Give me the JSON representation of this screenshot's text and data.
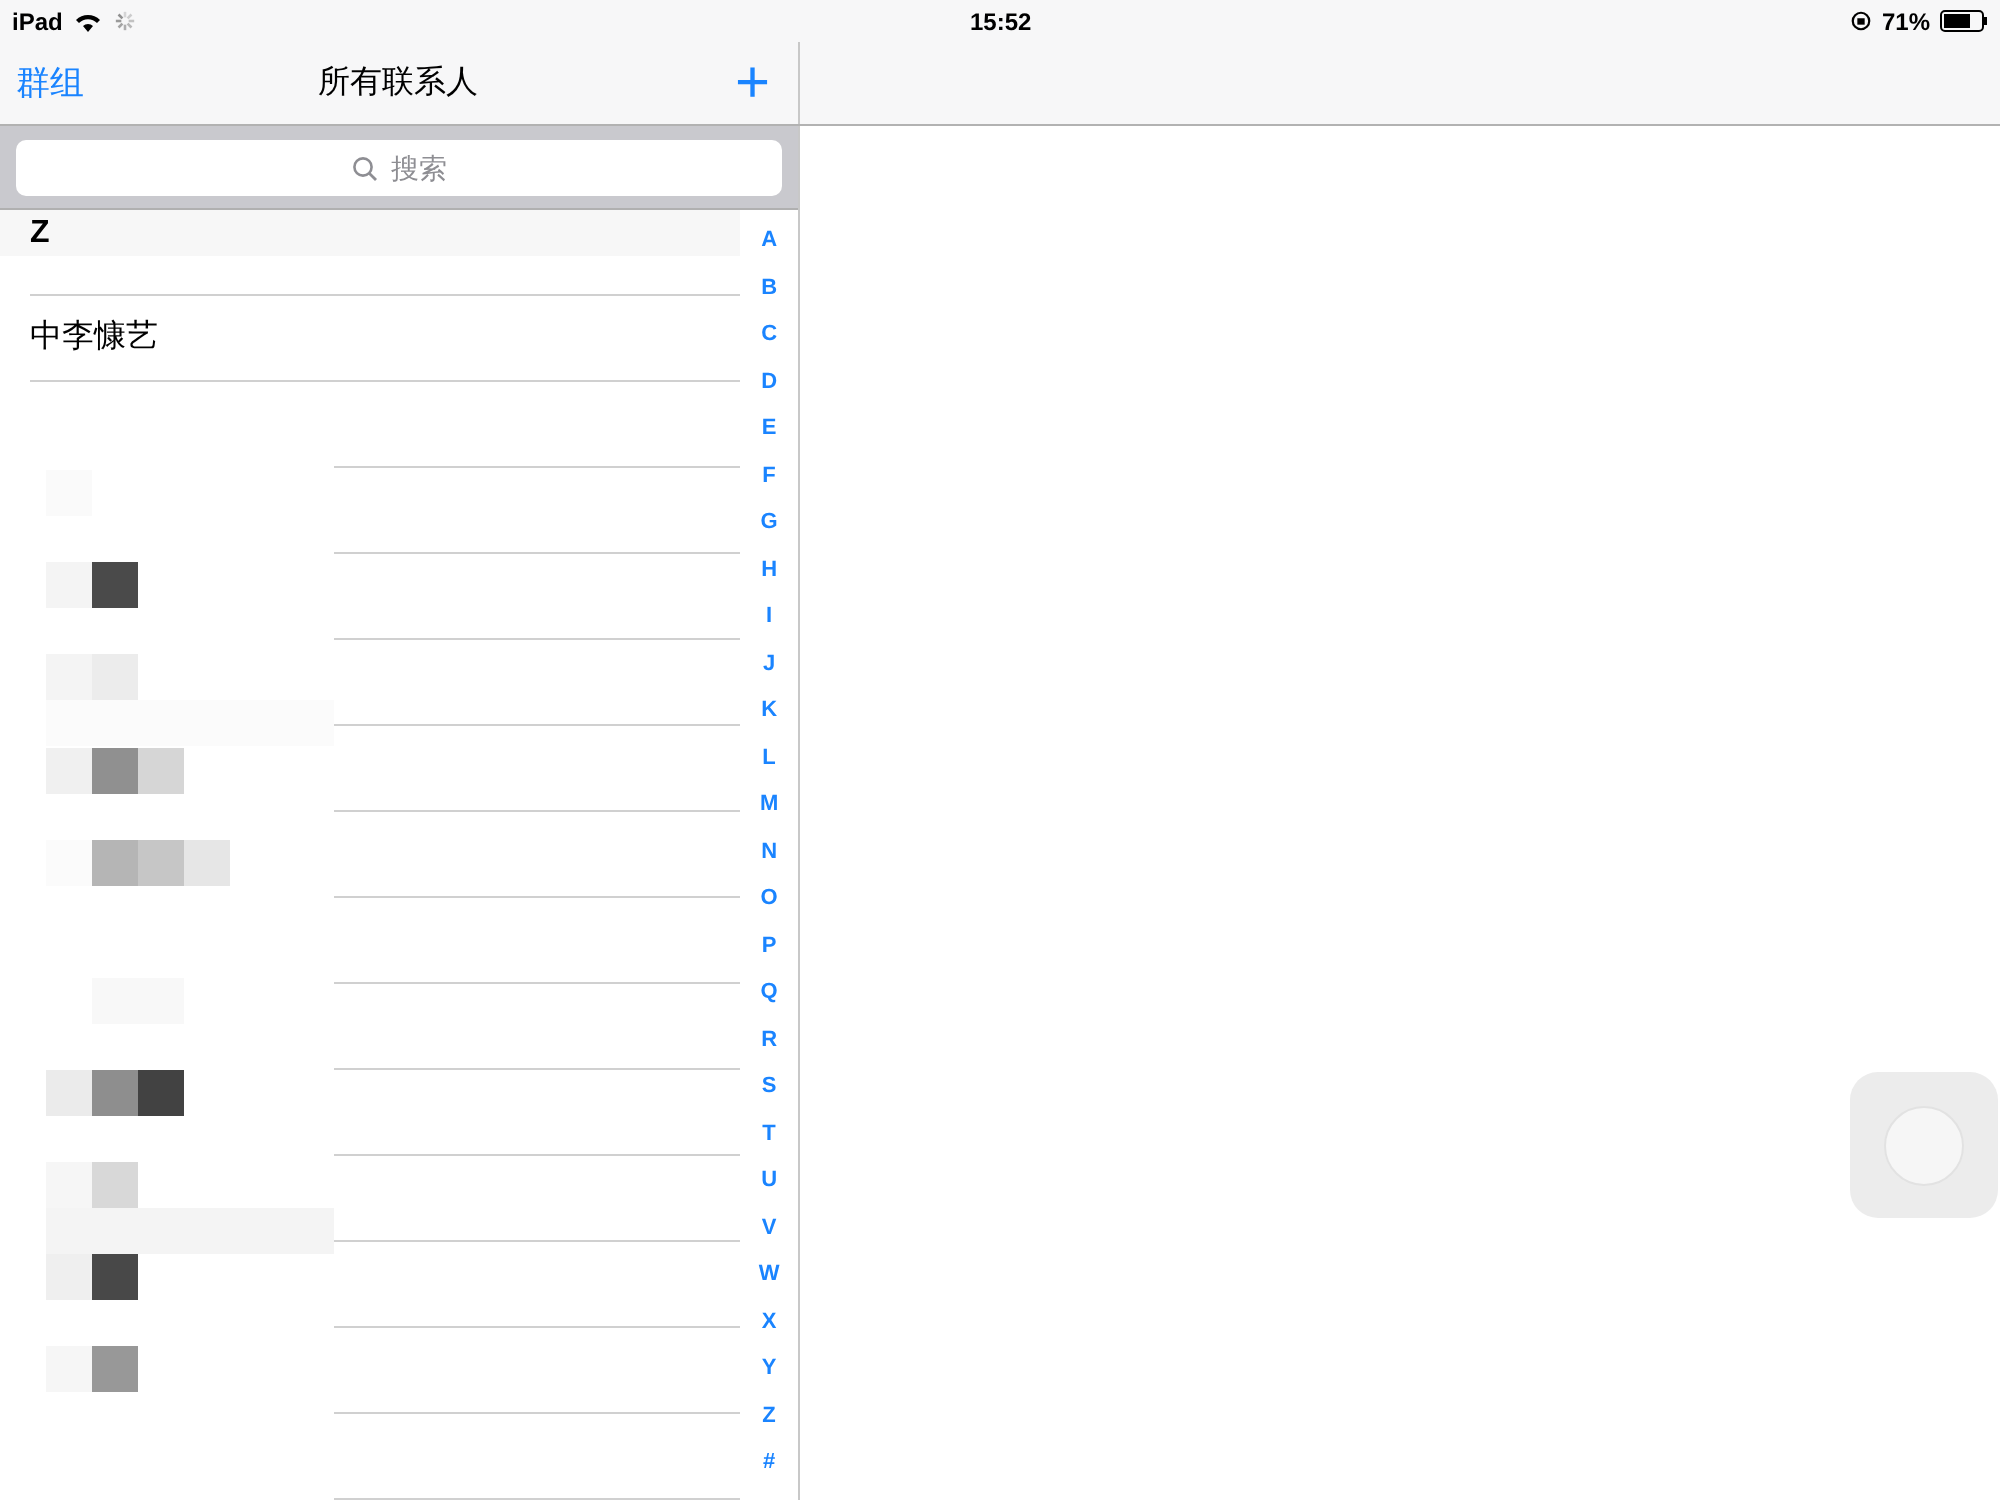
{
  "status_bar": {
    "device": "iPad",
    "time": "15:52",
    "battery": "71%"
  },
  "nav_bar": {
    "left": "群组",
    "title": "所有联系人",
    "add": "+"
  },
  "search": {
    "placeholder": "搜索"
  },
  "section_header": "Z",
  "contacts": [
    "中李慷艺"
  ],
  "index": [
    "A",
    "B",
    "C",
    "D",
    "E",
    "F",
    "G",
    "H",
    "I",
    "J",
    "K",
    "L",
    "M",
    "N",
    "O",
    "P",
    "Q",
    "R",
    "S",
    "T",
    "U",
    "V",
    "W",
    "X",
    "Y",
    "Z",
    "#"
  ]
}
